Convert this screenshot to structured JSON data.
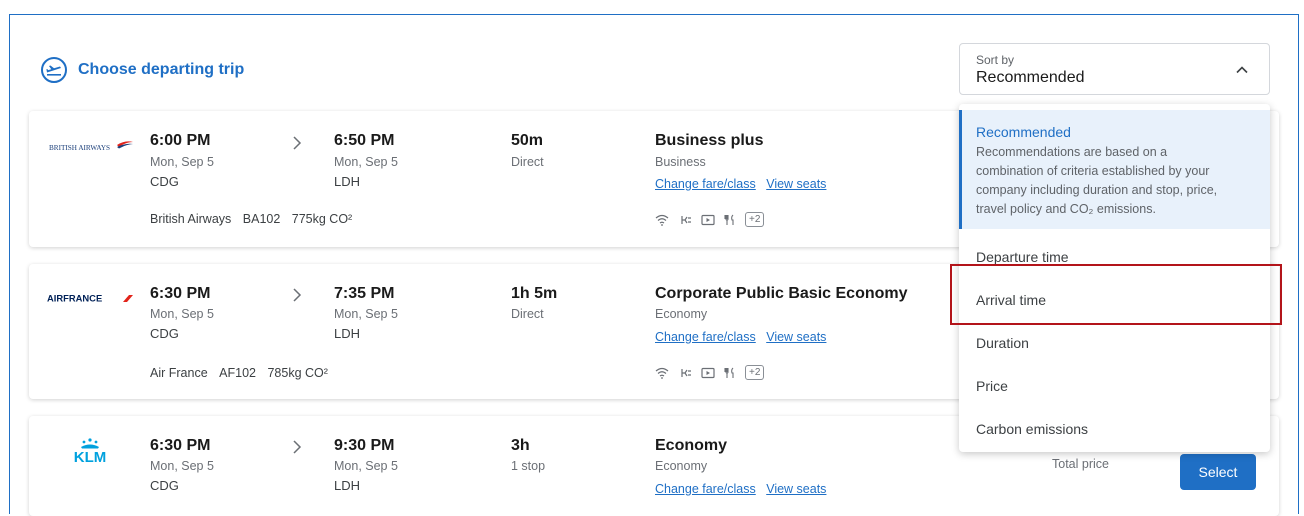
{
  "header": {
    "title": "Choose departing trip",
    "icon": "plane-circle-icon"
  },
  "sort": {
    "label": "Sort by",
    "value": "Recommended",
    "options": [
      {
        "name": "Recommended",
        "desc_lines": [
          "Recommendations are based on a",
          "combination of criteria established by your",
          "company including duration and stop, price,",
          "travel policy and CO₂ emissions."
        ]
      },
      {
        "name": "Departure time"
      },
      {
        "name": "Arrival time"
      },
      {
        "name": "Duration"
      },
      {
        "name": "Price"
      },
      {
        "name": "Carbon emissions"
      }
    ]
  },
  "flights": [
    {
      "airline": "British Airways",
      "logo_text": "BRITISH AIRWAYS",
      "dep_time": "6:00 PM",
      "dep_date": "Mon, Sep 5",
      "dep_code": "CDG",
      "arr_time": "6:50 PM",
      "arr_date": "Mon, Sep 5",
      "arr_code": "LDH",
      "duration": "50m",
      "stops": "Direct",
      "fare": "Business plus",
      "cabin": "Business",
      "change_link": "Change fare/class",
      "seats_link": "View seats",
      "flight_no": "BA102",
      "co2": "775kg CO²",
      "amenity_more": "+2"
    },
    {
      "airline": "Air France",
      "logo_text": "AIRFRANCE",
      "dep_time": "6:30 PM",
      "dep_date": "Mon, Sep 5",
      "dep_code": "CDG",
      "arr_time": "7:35 PM",
      "arr_date": "Mon, Sep 5",
      "arr_code": "LDH",
      "duration": "1h 5m",
      "stops": "Direct",
      "fare": "Corporate Public Basic Economy",
      "cabin": "Economy",
      "change_link": "Change fare/class",
      "seats_link": "View seats",
      "flight_no": "AF102",
      "co2": "785kg CO²",
      "amenity_more": "+2"
    },
    {
      "airline": "KLM",
      "logo_text": "KLM",
      "dep_time": "6:30 PM",
      "dep_date": "Mon, Sep 5",
      "dep_code": "CDG",
      "arr_time": "9:30 PM",
      "arr_date": "Mon, Sep 5",
      "arr_code": "LDH",
      "duration": "3h",
      "stops": "1 stop",
      "fare": "Economy",
      "cabin": "Economy",
      "change_link": "Change fare/class",
      "seats_link": "View seats",
      "total_price_label": "Total price",
      "select_label": "Select"
    }
  ],
  "colors": {
    "accent": "#1f6fc5",
    "highlight": "#b3141a",
    "ba": "#1b3f7a",
    "af": "#002157",
    "af_red": "#e2231a",
    "klm": "#00a1de"
  }
}
